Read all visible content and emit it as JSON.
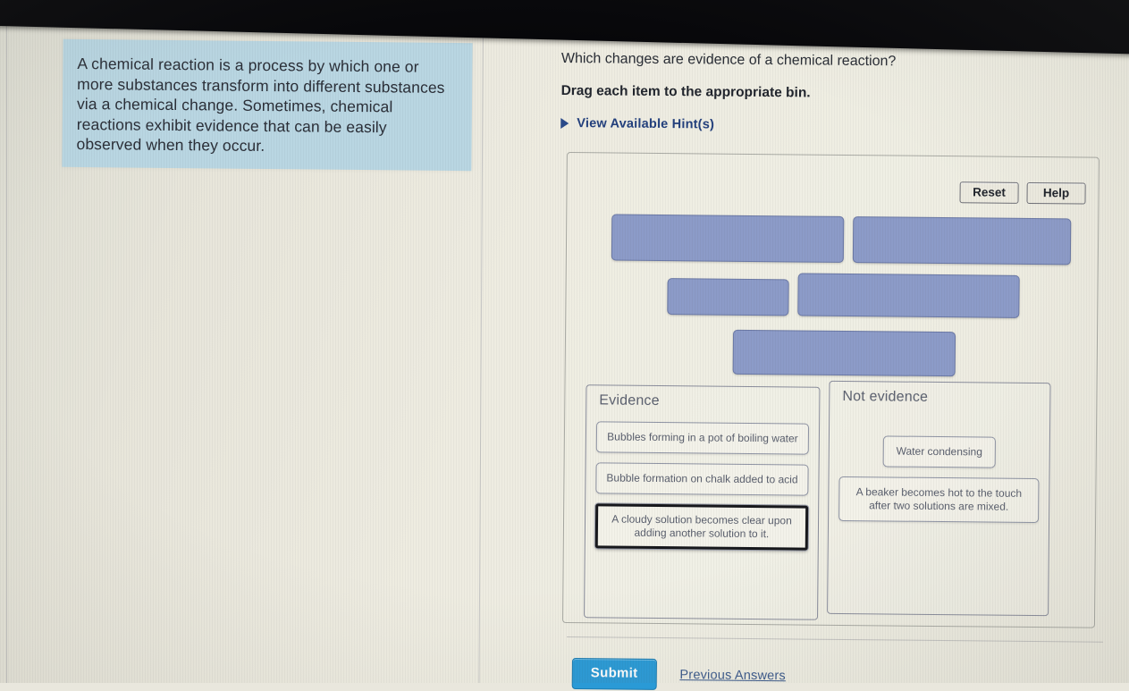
{
  "info_panel": {
    "text": "A chemical reaction is a process by which one or more substances transform into different substances via a chemical change. Sometimes, chemical reactions exhibit evidence that can be easily observed when they occur."
  },
  "question": {
    "prompt": "Which changes are evidence of a chemical reaction?",
    "instruction": "Drag each item to the appropriate bin.",
    "hint_label": "View Available Hint(s)",
    "hint_icon": "triangle-right-icon"
  },
  "toolbar": {
    "reset_label": "Reset",
    "help_label": "Help"
  },
  "bank": {
    "placeholders": [
      {
        "id": "placeholder-1",
        "label": ""
      },
      {
        "id": "placeholder-2",
        "label": ""
      },
      {
        "id": "placeholder-3",
        "label": ""
      },
      {
        "id": "placeholder-4",
        "label": ""
      },
      {
        "id": "placeholder-5",
        "label": ""
      }
    ]
  },
  "bins": [
    {
      "title": "Evidence",
      "items": [
        {
          "text": "Bubbles forming in a pot of boiling water",
          "selected": false
        },
        {
          "text": "Bubble formation on chalk added to acid",
          "selected": false
        },
        {
          "text": "A cloudy solution becomes clear upon adding another solution to it.",
          "selected": true
        }
      ]
    },
    {
      "title": "Not evidence",
      "items": [
        {
          "text": "Water condensing",
          "selected": false
        },
        {
          "text": "A beaker becomes hot to the touch after two solutions are mixed.",
          "selected": false
        }
      ]
    }
  ],
  "footer": {
    "submit_label": "Submit",
    "previous_answers_label": "Previous Answers"
  },
  "colors": {
    "chip_blue": "#8c9bc8",
    "info_panel_blue": "#b9d6e2",
    "submit_blue": "#2a9ad6",
    "link_blue": "#3c5a8c",
    "screen_bg": "#eeece1"
  }
}
